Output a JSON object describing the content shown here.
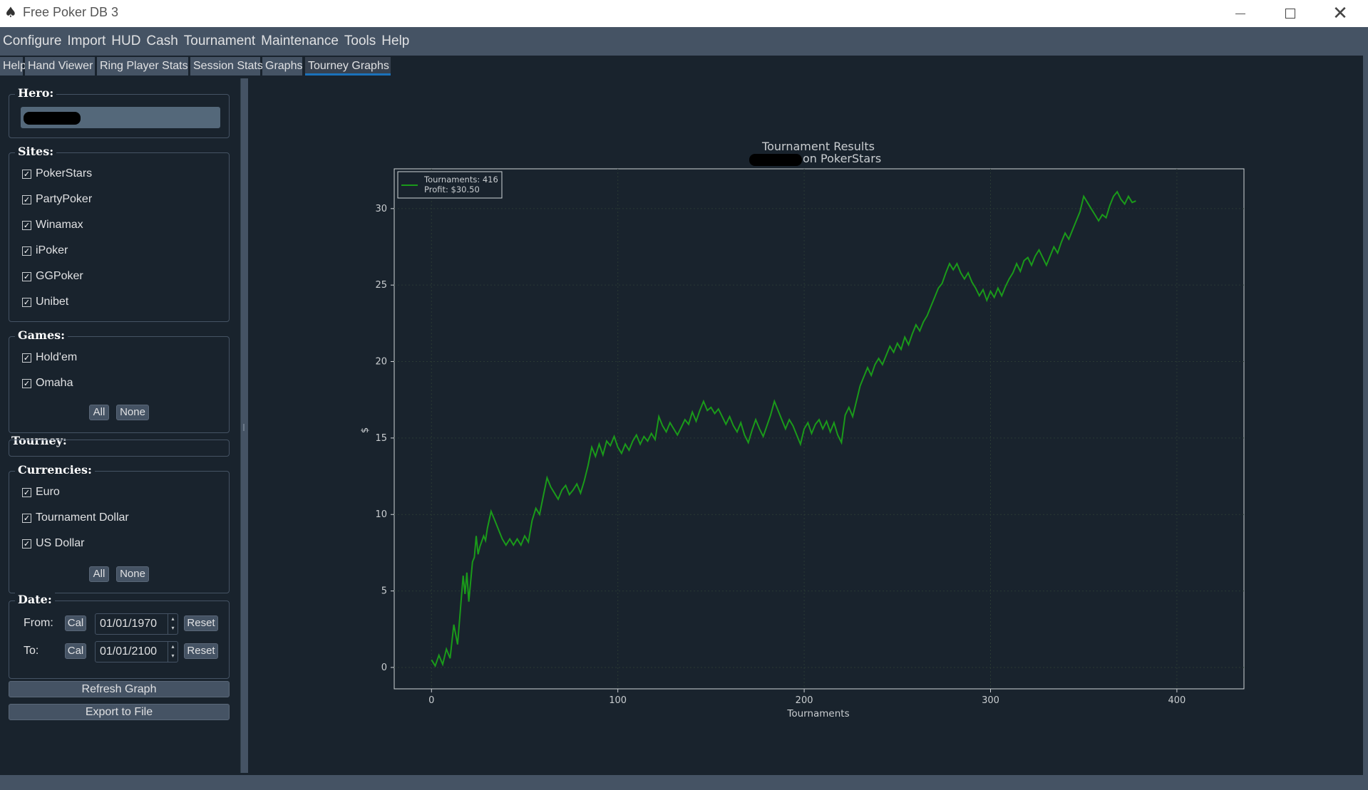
{
  "window": {
    "title": "Free Poker DB 3",
    "icon": "spade-icon"
  },
  "menu": [
    "Configure",
    "Import",
    "HUD",
    "Cash",
    "Tournament",
    "Maintenance",
    "Tools",
    "Help"
  ],
  "tabs": [
    "Help",
    "Hand Viewer",
    "Ring Player Stats",
    "Session Stats",
    "Graphs",
    "Tourney Graphs"
  ],
  "active_tab": "Tourney Graphs",
  "filters": {
    "hero": {
      "title": "Hero:"
    },
    "sites": {
      "title": "Sites:",
      "items": [
        {
          "label": "PokerStars",
          "checked": true
        },
        {
          "label": "PartyPoker",
          "checked": true
        },
        {
          "label": "Winamax",
          "checked": true
        },
        {
          "label": "iPoker",
          "checked": true
        },
        {
          "label": "GGPoker",
          "checked": true
        },
        {
          "label": "Unibet",
          "checked": true
        }
      ]
    },
    "games": {
      "title": "Games:",
      "items": [
        {
          "label": "Hold'em",
          "checked": true
        },
        {
          "label": "Omaha",
          "checked": true
        }
      ],
      "all_label": "All",
      "none_label": "None"
    },
    "tourney": {
      "title": "Tourney:"
    },
    "currencies": {
      "title": "Currencies:",
      "items": [
        {
          "label": "Euro",
          "checked": true
        },
        {
          "label": "Tournament Dollar",
          "checked": true
        },
        {
          "label": "US Dollar",
          "checked": true
        }
      ],
      "all_label": "All",
      "none_label": "None"
    },
    "date": {
      "title": "Date:",
      "from_label": "From:",
      "to_label": "To:",
      "cal_label": "Cal",
      "reset_label": "Reset",
      "from_value": "01/01/1970",
      "to_value": "01/01/2100"
    }
  },
  "buttons": {
    "refresh": "Refresh Graph",
    "export": "Export to File"
  },
  "colors": {
    "background": "#19232d",
    "line": "#1a9a1a",
    "text": "#c9cdd0"
  },
  "chart_data": {
    "type": "line",
    "title": "Tournament Results",
    "subtitle": "on PokerStars",
    "xlabel": "Tournaments",
    "ylabel": "$",
    "xlim": [
      -20,
      436
    ],
    "ylim": [
      -1.4,
      32.6
    ],
    "xticks": [
      0,
      100,
      200,
      300,
      400
    ],
    "yticks": [
      0,
      5,
      10,
      15,
      20,
      25,
      30
    ],
    "legend": {
      "position": "top-left",
      "lines": [
        "Tournaments: 416",
        "Profit: $30.50"
      ]
    },
    "grid": true,
    "series": [
      {
        "points": [
          [
            0,
            0.5
          ],
          [
            2,
            0.1
          ],
          [
            4,
            0.8
          ],
          [
            6,
            0.2
          ],
          [
            8,
            1.2
          ],
          [
            10,
            0.6
          ],
          [
            12,
            2.8
          ],
          [
            14,
            1.5
          ],
          [
            16,
            4.5
          ],
          [
            17,
            6.0
          ],
          [
            18,
            4.8
          ],
          [
            19,
            6.2
          ],
          [
            20,
            4.3
          ],
          [
            21,
            5.6
          ],
          [
            22,
            6.9
          ],
          [
            23,
            7.2
          ],
          [
            24,
            8.6
          ],
          [
            25,
            7.4
          ],
          [
            26,
            7.9
          ],
          [
            28,
            8.6
          ],
          [
            29,
            8.3
          ],
          [
            30,
            9.1
          ],
          [
            32,
            10.2
          ],
          [
            34,
            9.6
          ],
          [
            36,
            9.0
          ],
          [
            38,
            8.4
          ],
          [
            40,
            8.0
          ],
          [
            42,
            8.4
          ],
          [
            44,
            8.0
          ],
          [
            46,
            8.4
          ],
          [
            48,
            8.0
          ],
          [
            50,
            8.6
          ],
          [
            52,
            8.2
          ],
          [
            54,
            9.6
          ],
          [
            56,
            10.4
          ],
          [
            58,
            10.0
          ],
          [
            60,
            11.2
          ],
          [
            62,
            12.4
          ],
          [
            64,
            11.8
          ],
          [
            66,
            11.4
          ],
          [
            68,
            11.0
          ],
          [
            70,
            11.6
          ],
          [
            72,
            11.9
          ],
          [
            74,
            11.3
          ],
          [
            76,
            11.6
          ],
          [
            78,
            12.0
          ],
          [
            80,
            11.4
          ],
          [
            82,
            12.2
          ],
          [
            84,
            13.2
          ],
          [
            86,
            14.4
          ],
          [
            88,
            13.8
          ],
          [
            90,
            14.6
          ],
          [
            92,
            13.9
          ],
          [
            94,
            14.8
          ],
          [
            96,
            14.5
          ],
          [
            98,
            15.1
          ],
          [
            100,
            14.4
          ],
          [
            102,
            14.0
          ],
          [
            104,
            14.6
          ],
          [
            106,
            14.2
          ],
          [
            108,
            14.8
          ],
          [
            110,
            15.2
          ],
          [
            112,
            14.6
          ],
          [
            114,
            15.1
          ],
          [
            116,
            14.8
          ],
          [
            118,
            15.3
          ],
          [
            120,
            14.9
          ],
          [
            122,
            16.4
          ],
          [
            124,
            15.8
          ],
          [
            126,
            15.4
          ],
          [
            128,
            16.0
          ],
          [
            130,
            15.6
          ],
          [
            132,
            15.2
          ],
          [
            134,
            15.7
          ],
          [
            136,
            16.2
          ],
          [
            138,
            15.9
          ],
          [
            140,
            16.7
          ],
          [
            142,
            16.1
          ],
          [
            144,
            16.8
          ],
          [
            146,
            17.4
          ],
          [
            148,
            16.8
          ],
          [
            150,
            17.0
          ],
          [
            152,
            16.6
          ],
          [
            154,
            16.9
          ],
          [
            156,
            16.4
          ],
          [
            158,
            15.9
          ],
          [
            160,
            16.4
          ],
          [
            162,
            15.8
          ],
          [
            164,
            15.4
          ],
          [
            166,
            16.0
          ],
          [
            168,
            15.2
          ],
          [
            170,
            14.7
          ],
          [
            172,
            15.5
          ],
          [
            174,
            16.2
          ],
          [
            176,
            15.6
          ],
          [
            178,
            15.1
          ],
          [
            180,
            15.8
          ],
          [
            182,
            16.5
          ],
          [
            184,
            17.4
          ],
          [
            186,
            16.8
          ],
          [
            188,
            16.2
          ],
          [
            190,
            15.6
          ],
          [
            192,
            16.2
          ],
          [
            194,
            15.8
          ],
          [
            196,
            15.2
          ],
          [
            198,
            14.6
          ],
          [
            200,
            15.6
          ],
          [
            202,
            16.0
          ],
          [
            204,
            15.3
          ],
          [
            206,
            15.9
          ],
          [
            208,
            16.2
          ],
          [
            210,
            15.6
          ],
          [
            212,
            16.1
          ],
          [
            214,
            15.4
          ],
          [
            216,
            16.0
          ],
          [
            218,
            15.2
          ],
          [
            220,
            14.7
          ],
          [
            222,
            16.5
          ],
          [
            224,
            17.0
          ],
          [
            226,
            16.4
          ],
          [
            228,
            17.4
          ],
          [
            230,
            18.4
          ],
          [
            232,
            19.0
          ],
          [
            234,
            19.6
          ],
          [
            236,
            19.1
          ],
          [
            238,
            19.8
          ],
          [
            240,
            20.2
          ],
          [
            242,
            19.8
          ],
          [
            244,
            20.4
          ],
          [
            246,
            21.0
          ],
          [
            248,
            20.6
          ],
          [
            250,
            21.2
          ],
          [
            252,
            20.8
          ],
          [
            254,
            21.6
          ],
          [
            256,
            21.1
          ],
          [
            258,
            21.8
          ],
          [
            260,
            22.4
          ],
          [
            262,
            22.0
          ],
          [
            264,
            22.6
          ],
          [
            266,
            23.0
          ],
          [
            268,
            23.6
          ],
          [
            270,
            24.2
          ],
          [
            272,
            24.8
          ],
          [
            274,
            25.1
          ],
          [
            276,
            25.8
          ],
          [
            278,
            26.4
          ],
          [
            280,
            26.0
          ],
          [
            282,
            26.4
          ],
          [
            284,
            25.8
          ],
          [
            286,
            25.4
          ],
          [
            288,
            25.8
          ],
          [
            290,
            25.2
          ],
          [
            292,
            24.8
          ],
          [
            294,
            24.3
          ],
          [
            296,
            24.7
          ],
          [
            298,
            24.0
          ],
          [
            300,
            24.6
          ],
          [
            302,
            24.2
          ],
          [
            304,
            24.8
          ],
          [
            306,
            24.3
          ],
          [
            308,
            24.9
          ],
          [
            310,
            25.4
          ],
          [
            312,
            25.8
          ],
          [
            314,
            26.4
          ],
          [
            316,
            25.9
          ],
          [
            318,
            26.6
          ],
          [
            320,
            26.8
          ],
          [
            322,
            26.3
          ],
          [
            324,
            26.9
          ],
          [
            326,
            27.3
          ],
          [
            328,
            26.8
          ],
          [
            330,
            26.3
          ],
          [
            332,
            26.9
          ],
          [
            334,
            27.5
          ],
          [
            336,
            27.1
          ],
          [
            338,
            27.8
          ],
          [
            340,
            28.4
          ],
          [
            342,
            28.0
          ],
          [
            344,
            28.6
          ],
          [
            346,
            29.2
          ],
          [
            348,
            29.8
          ],
          [
            350,
            30.8
          ],
          [
            352,
            30.4
          ],
          [
            354,
            30.0
          ],
          [
            356,
            29.6
          ],
          [
            358,
            29.2
          ],
          [
            360,
            29.6
          ],
          [
            362,
            29.4
          ],
          [
            364,
            30.2
          ],
          [
            366,
            30.8
          ],
          [
            368,
            31.1
          ],
          [
            370,
            30.6
          ],
          [
            372,
            30.3
          ],
          [
            374,
            30.8
          ],
          [
            376,
            30.4
          ],
          [
            378,
            30.5
          ]
        ]
      }
    ]
  }
}
